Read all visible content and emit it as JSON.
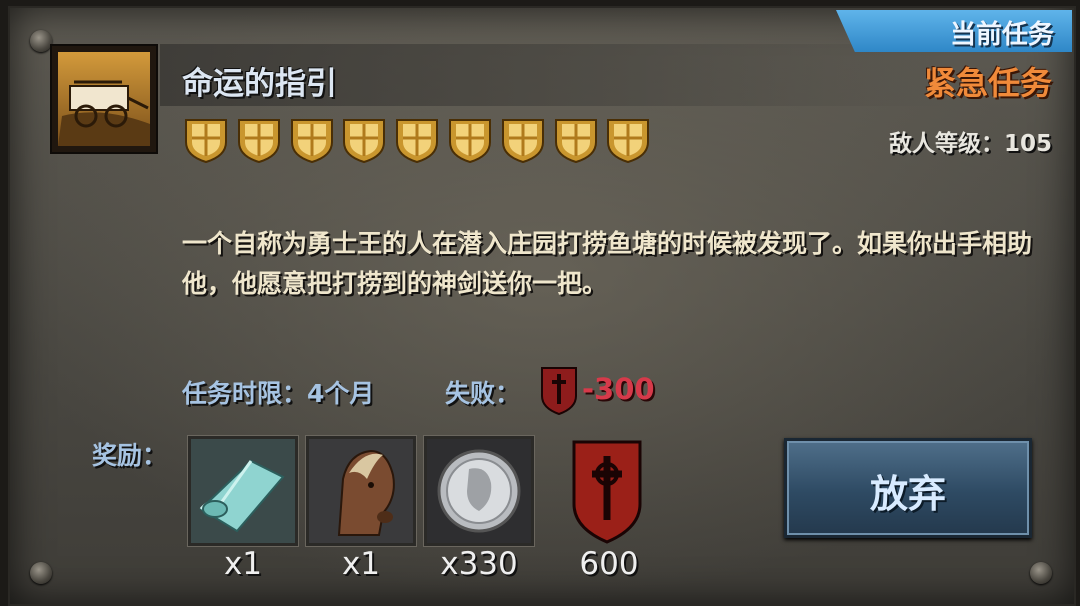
{
  "quest": {
    "title": "命运的指引",
    "tab_label": "当前任务",
    "status": "紧急任务",
    "enemy_level_text": "敌人等级：105",
    "star_count": 9,
    "icon": "caravan-wagon-icon",
    "description": "一个自称为勇士王的人在潜入庄园打捞鱼塘的时候被发现了。如果你出手相助他，他愿意把打捞到的神剑送你一把。",
    "time_limit_text": "任务时限：4个月",
    "fail_label": "失败：",
    "fail_value": "-300"
  },
  "rewards": {
    "label": "奖励：",
    "items": [
      {
        "icon": "cloth-roll-icon",
        "qty": "x1"
      },
      {
        "icon": "horse-icon",
        "qty": "x1"
      },
      {
        "icon": "silver-coin-icon",
        "qty": "x330"
      },
      {
        "icon": "honor-shield-icon",
        "qty": "600"
      }
    ]
  },
  "actions": {
    "abandon_label": "放弃"
  },
  "colors": {
    "accent_tab": "#3b94d6",
    "urgent": "#f08a3a",
    "fail": "#d63a4a",
    "label_blue": "#a6c3e2"
  }
}
